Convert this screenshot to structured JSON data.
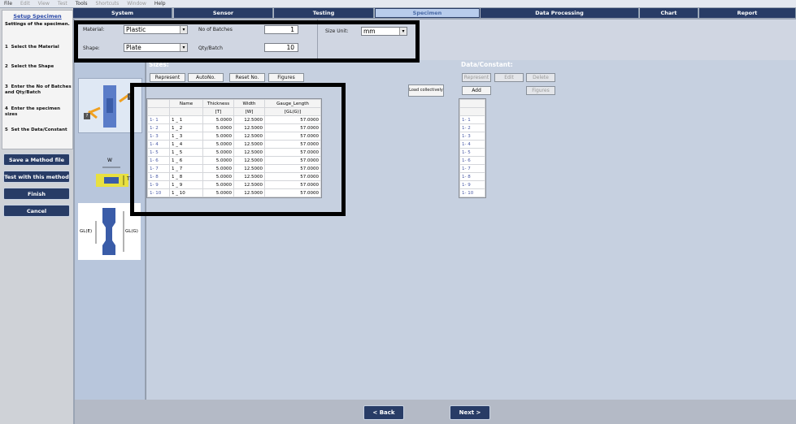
{
  "menu": [
    {
      "label": "File",
      "enabled": true
    },
    {
      "label": "Edit",
      "enabled": false
    },
    {
      "label": "View",
      "enabled": false
    },
    {
      "label": "Test",
      "enabled": false
    },
    {
      "label": "Tools",
      "enabled": true
    },
    {
      "label": "Shortcuts",
      "enabled": false
    },
    {
      "label": "Window",
      "enabled": false
    },
    {
      "label": "Help",
      "enabled": true
    }
  ],
  "tabs": [
    "System",
    "Sensor",
    "Testing",
    "Specimen",
    "Data Processing",
    "Chart",
    "Report"
  ],
  "active_tab": "Specimen",
  "left": {
    "title": "Setup Specimen",
    "subtitle": "Settings of the specimen.",
    "steps": [
      {
        "num": "1",
        "text": "Select the Material"
      },
      {
        "num": "2",
        "text": "Select the Shape"
      },
      {
        "num": "3",
        "text": "Enter the No of Batches and Qty/Batch"
      },
      {
        "num": "4",
        "text": "Enter the specimen sizes"
      },
      {
        "num": "5",
        "text": "Set the Data/Constant"
      }
    ],
    "buttons": [
      "Save a Method file",
      "Test with this method",
      "Finish",
      "Cancel"
    ]
  },
  "form": {
    "material_label": "Material:",
    "material": "Plastic",
    "shape_label": "Shape:",
    "shape": "Plate",
    "batches_label": "No of Batches",
    "batches": "1",
    "qty_label": "Qty/Batch",
    "qty": "10",
    "unit_label": "Size Unit:",
    "unit": "mm"
  },
  "images": {
    "w_label": "W",
    "t_label": "T",
    "gle_label": "GL(E)",
    "glg_label": "GL(G)"
  },
  "sizes": {
    "title": "Sizes:",
    "buttons": [
      "Represent",
      "AutoNo.",
      "Reset No.",
      "Figures"
    ],
    "load_btn": "Load collectively",
    "columns": [
      "Name",
      "Thickness",
      "Width",
      "Gauge_Length"
    ],
    "units": [
      "[T]",
      "[W]",
      "[GL(G)]"
    ],
    "rows": [
      {
        "id": "1- 1",
        "name": "1 _ 1",
        "t": "5.0000",
        "w": "12.5000",
        "gl": "57.0000"
      },
      {
        "id": "1- 2",
        "name": "1 _ 2",
        "t": "5.0000",
        "w": "12.5000",
        "gl": "57.0000"
      },
      {
        "id": "1- 3",
        "name": "1 _ 3",
        "t": "5.0000",
        "w": "12.5000",
        "gl": "57.0000"
      },
      {
        "id": "1- 4",
        "name": "1 _ 4",
        "t": "5.0000",
        "w": "12.5000",
        "gl": "57.0000"
      },
      {
        "id": "1- 5",
        "name": "1 _ 5",
        "t": "5.0000",
        "w": "12.5000",
        "gl": "57.0000"
      },
      {
        "id": "1- 6",
        "name": "1 _ 6",
        "t": "5.0000",
        "w": "12.5000",
        "gl": "57.0000"
      },
      {
        "id": "1- 7",
        "name": "1 _ 7",
        "t": "5.0000",
        "w": "12.5000",
        "gl": "57.0000"
      },
      {
        "id": "1- 8",
        "name": "1 _ 8",
        "t": "5.0000",
        "w": "12.5000",
        "gl": "57.0000"
      },
      {
        "id": "1- 9",
        "name": "1 _ 9",
        "t": "5.0000",
        "w": "12.5000",
        "gl": "57.0000"
      },
      {
        "id": "1- 10",
        "name": "1 _ 10",
        "t": "5.0000",
        "w": "12.5000",
        "gl": "57.0000"
      }
    ]
  },
  "data": {
    "title": "Data/Constant:",
    "buttons": [
      "Represent",
      "Edit",
      "Delete",
      "Add",
      "Figures"
    ],
    "rows": [
      "1- 1",
      "1- 2",
      "1- 3",
      "1- 4",
      "1- 5",
      "1- 6",
      "1- 7",
      "1- 8",
      "1- 9",
      "1- 10"
    ]
  },
  "nav": {
    "back": "< Back",
    "next": "Next >"
  },
  "colors": {
    "nav_dark": "#283c66",
    "active_tab": "#b8ccec",
    "panel": "#c6d0e0"
  }
}
